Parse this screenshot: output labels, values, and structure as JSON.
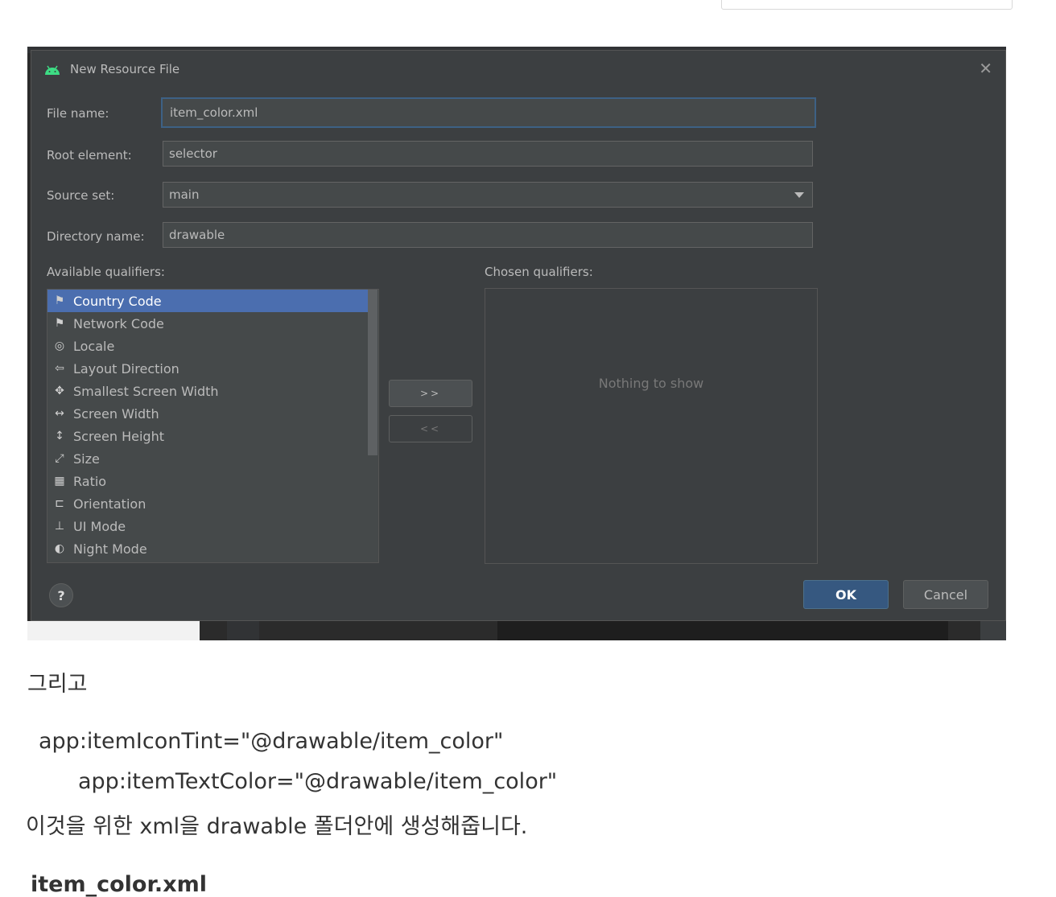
{
  "dialog": {
    "title": "New Resource File",
    "close_glyph": "✕",
    "fields": {
      "file_name": {
        "label": "File name:",
        "value": "item_color.xml"
      },
      "root_element": {
        "label": "Root element:",
        "value": "selector"
      },
      "source_set": {
        "label": "Source set:",
        "value": "main"
      },
      "directory_name": {
        "label": "Directory name:",
        "value": "drawable"
      }
    },
    "available_label": "Available qualifiers:",
    "chosen_label": "Chosen qualifiers:",
    "qualifiers": [
      {
        "label": "Country Code",
        "icon": "country-code-icon",
        "glyph": "⚑"
      },
      {
        "label": "Network Code",
        "icon": "network-code-icon",
        "glyph": "⚑"
      },
      {
        "label": "Locale",
        "icon": "globe-icon",
        "glyph": "◎"
      },
      {
        "label": "Layout Direction",
        "icon": "arrow-left-icon",
        "glyph": "⇦"
      },
      {
        "label": "Smallest Screen Width",
        "icon": "expand-icon",
        "glyph": "✥"
      },
      {
        "label": "Screen Width",
        "icon": "horizontal-arrows-icon",
        "glyph": "↔"
      },
      {
        "label": "Screen Height",
        "icon": "vertical-arrows-icon",
        "glyph": "↕"
      },
      {
        "label": "Size",
        "icon": "resize-icon",
        "glyph": "⤢"
      },
      {
        "label": "Ratio",
        "icon": "ratio-icon",
        "glyph": "▦"
      },
      {
        "label": "Orientation",
        "icon": "orientation-icon",
        "glyph": "⊏"
      },
      {
        "label": "UI Mode",
        "icon": "ui-mode-icon",
        "glyph": "⊥"
      },
      {
        "label": "Night Mode",
        "icon": "moon-icon",
        "glyph": "◐"
      }
    ],
    "add_button": ">>",
    "remove_button": "<<",
    "chosen_empty": "Nothing to show",
    "help_button": "?",
    "ok_button": "OK",
    "cancel_button": "Cancel"
  },
  "article": {
    "line1": "그리고",
    "line2": "app:itemIconTint=\"@drawable/item_color\"",
    "line3": "app:itemTextColor=\"@drawable/item_color\"",
    "line4": "이것을 위한 xml을 drawable 폴더안에 생성해줍니다.",
    "heading": "item_color.xml"
  },
  "colors": {
    "dialog_bg": "#3c3f41",
    "selection": "#4b6eaf",
    "ok_button": "#365880",
    "android_green": "#3ddc84"
  }
}
